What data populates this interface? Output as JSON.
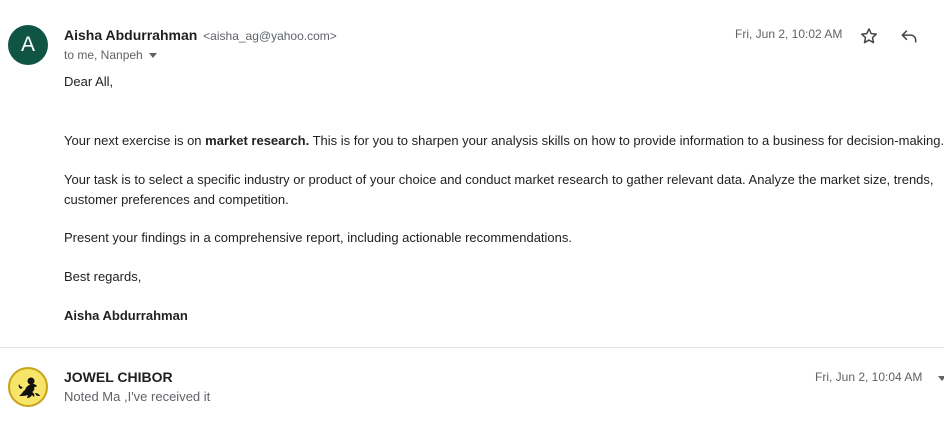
{
  "message1": {
    "avatar_letter": "A",
    "avatar_color": "#0f5445",
    "sender_name": "Aisha Abdurrahman",
    "sender_email": "<aisha_ag@yahoo.com>",
    "recipients": "to me, Nanpeh",
    "date": "Fri, Jun 2, 10:02 AM",
    "body": {
      "greeting": "Dear All,",
      "para1_before": "Your next exercise is on ",
      "para1_bold": "market research.",
      "para1_after": " This is for you to sharpen your analysis skills on how to provide information to a business for decision-making.",
      "para2": "Your task is to select a specific industry or product of your choice and conduct market research to gather relevant data. Analyze the market size, trends, customer preferences and competition.",
      "para3": "Present your findings in a comprehensive report, including actionable recommendations.",
      "closing": "Best regards,",
      "signature": "Aisha Abdurrahman"
    },
    "icons": {
      "star": "star-icon",
      "reply": "reply-icon"
    }
  },
  "message2": {
    "sender_name": "JOWEL CHIBOR",
    "snippet": "Noted Ma ,I've received it",
    "date": "Fri, Jun 2, 10:04 AM",
    "avatar_icon": "monkey-avatar-icon"
  }
}
